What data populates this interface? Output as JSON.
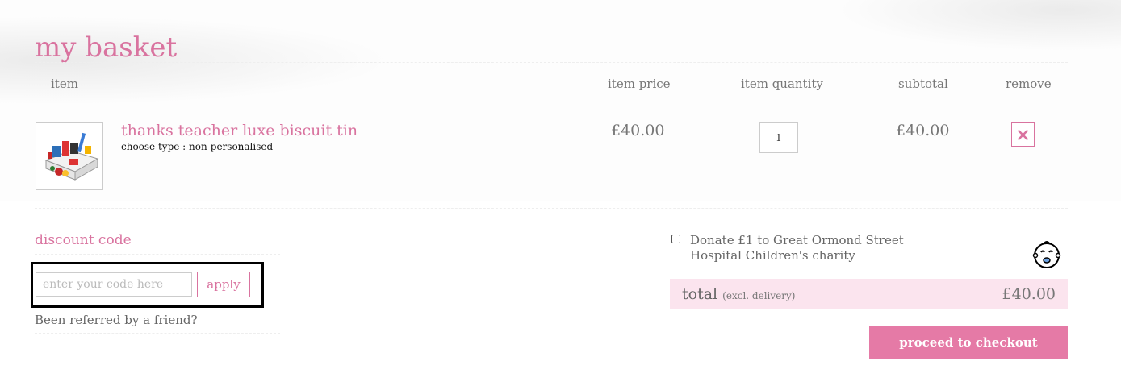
{
  "page": {
    "title": "my basket"
  },
  "table": {
    "headers": {
      "item": "item",
      "price": "item price",
      "quantity": "item quantity",
      "subtotal": "subtotal",
      "remove": "remove"
    },
    "rows": [
      {
        "name": "thanks teacher luxe biscuit tin",
        "option": "choose type : non-personalised",
        "price": "£40.00",
        "quantity": "1",
        "subtotal": "£40.00"
      }
    ]
  },
  "discount": {
    "heading": "discount code",
    "placeholder": "enter your code here",
    "value": "",
    "apply_label": "apply",
    "referral_text": "Been referred by a friend?"
  },
  "donation": {
    "checked": false,
    "text": "Donate £1 to Great Ormond Street Hospital Children's charity",
    "icon": "baby-face-icon"
  },
  "totals": {
    "label": "total",
    "note": "(excl. delivery)",
    "value": "£40.00"
  },
  "checkout": {
    "label": "proceed to checkout"
  },
  "colors": {
    "accent": "#d9739f",
    "checkout_bg": "#e57aa6",
    "total_bg": "#fbe4ee"
  }
}
